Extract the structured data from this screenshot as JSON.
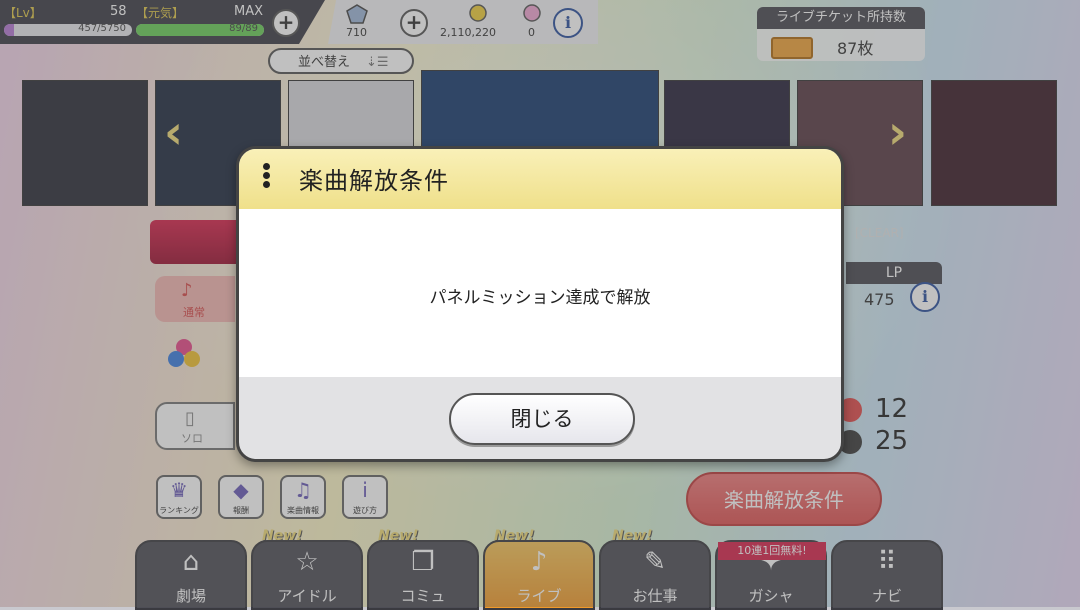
{
  "status": {
    "lv_label": "【Lv】",
    "lv_value": "58",
    "lv_exp": "457/5750",
    "lv_exp_fraction": 0.08,
    "genki_label": "【元気】",
    "genki_max_label": "MAX",
    "genki_value": "89/89",
    "genki_fraction": 1.0
  },
  "currency": {
    "gems": "710",
    "coins": "2,110,220",
    "other": "0"
  },
  "ticket": {
    "title": "ライブチケット所持数",
    "count": "87枚"
  },
  "sort_button": {
    "label": "並べ替え"
  },
  "song_panel": {
    "clear_label": "[CLEAR]",
    "lp_label": "LP",
    "lp_value": "475",
    "count_top": "12",
    "count_bottom": "25",
    "unlock_condition_button": "楽曲解放条件",
    "mode_normal": "通常",
    "mode_solo": "ソロ"
  },
  "tool_buttons": [
    {
      "label": "ランキング",
      "icon": "crown-icon"
    },
    {
      "label": "報酬",
      "icon": "gem-icon"
    },
    {
      "label": "楽曲情報",
      "icon": "music-note-icon"
    },
    {
      "label": "遊び方",
      "icon": "info-icon"
    }
  ],
  "nav": {
    "new_tag": "New!",
    "gacha_promo": "10連1回無料!",
    "items": [
      {
        "label": "劇場",
        "icon": "theater-icon"
      },
      {
        "label": "アイドル",
        "icon": "idol-icon"
      },
      {
        "label": "コミュ",
        "icon": "cards-icon"
      },
      {
        "label": "ライブ",
        "icon": "music-icon"
      },
      {
        "label": "お仕事",
        "icon": "notebook-icon"
      },
      {
        "label": "ガシャ",
        "icon": "gacha-icon"
      },
      {
        "label": "ナビ",
        "icon": "grid-icon"
      }
    ]
  },
  "modal": {
    "title": "楽曲解放条件",
    "message": "パネルミッション達成で解放",
    "close_label": "閉じる"
  },
  "colors": {
    "modal_header": "#f3e69c",
    "unlock_button": "#e86464",
    "active_nav": "#f4b041"
  }
}
